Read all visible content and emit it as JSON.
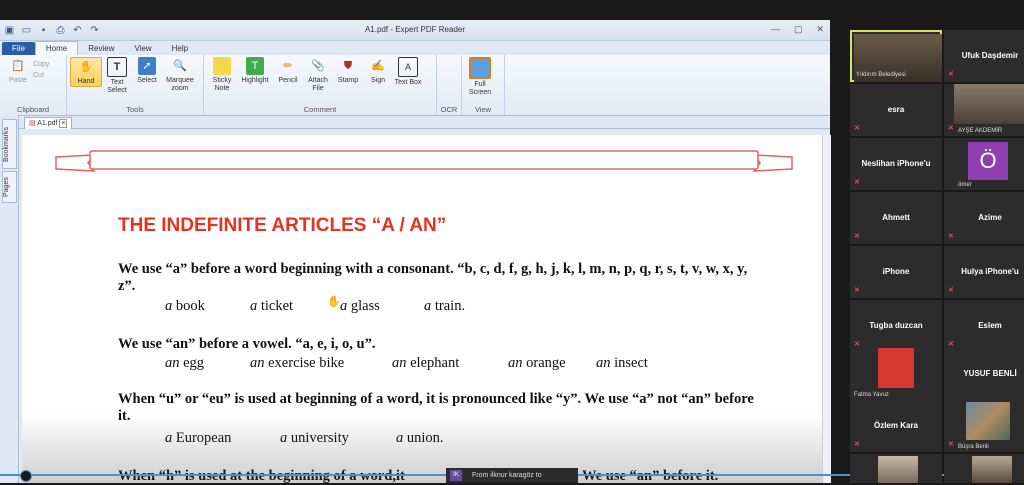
{
  "window_title": "A1.pdf - Expert PDF Reader",
  "tabs": [
    "File",
    "Home",
    "Review",
    "View",
    "Help"
  ],
  "ribbon": {
    "clipboard": {
      "label": "Clipboard",
      "paste": "Paste",
      "copy": "Copy",
      "cut": "Cut"
    },
    "tools": {
      "label": "Tools",
      "hand": "Hand",
      "text_select": "Text Select",
      "select": "Select",
      "marquee_zoom": "Marquee zoom"
    },
    "comment": {
      "label": "Comment",
      "sticky_note": "Sticky Note",
      "highlight": "Highlight",
      "pencil": "Pencil",
      "attach_file": "Attach File",
      "stamp": "Stamp",
      "sign": "Sign",
      "text_box": "Text Box"
    },
    "ocr": {
      "label": "OCR"
    },
    "view": {
      "label": "View",
      "full_screen": "Full Screen"
    }
  },
  "doc_tab": "A1.pdf",
  "side_tabs": [
    "Bookmarks",
    "Pages"
  ],
  "document": {
    "heading": "THE INDEFINITE ARTICLES “A / AN”",
    "p1": "We use “a” before a word beginning with a consonant. “b, c, d, f, g, h, j, k, l, m, n, p, q, r, s, t, v, w, x, y, z”.",
    "ex1": [
      [
        "a",
        "book"
      ],
      [
        "a",
        "ticket"
      ],
      [
        "a",
        "glass"
      ],
      [
        "a",
        "train."
      ]
    ],
    "p2": "We use “an” before a vowel. “a, e, i, o, u”.",
    "ex2": [
      [
        "an",
        "egg"
      ],
      [
        "an",
        "exercise bike"
      ],
      [
        "an",
        "elephant"
      ],
      [
        "an",
        "orange"
      ],
      [
        "an",
        "insect"
      ]
    ],
    "p3": "When “u” or “eu” is used at beginning of a word, it is pronounced like “y”. We use “a” not “an” before it.",
    "ex3": [
      [
        "a",
        "European"
      ],
      [
        "a",
        "university"
      ],
      [
        "a",
        "union."
      ]
    ],
    "p4_start": "When “h” is used at the beginning of a word,it",
    "p4_end": "We use “an” before it."
  },
  "notification": {
    "avatar": "IK",
    "text": "From ilknur karagöz to"
  },
  "participants": [
    {
      "name": "Yıldırım Belediyesi",
      "video": true
    },
    {
      "name": "Ufuk Daşdemir"
    },
    {
      "name": "esra"
    },
    {
      "name": "AYŞE AKDEMİR",
      "video": true
    },
    {
      "name": "Neslihan iPhone'u"
    },
    {
      "name": "ömer",
      "avatar": "Ö"
    },
    {
      "name": "Ahmett"
    },
    {
      "name": "Azime"
    },
    {
      "name": "iPhone"
    },
    {
      "name": "Hulya iPhone'u"
    },
    {
      "name": "Tugba duzcan"
    },
    {
      "name": "Eslem"
    },
    {
      "name": "Fatma Yavuz",
      "video": true
    },
    {
      "name": "YUSUF BENLİ"
    },
    {
      "name": "Özlem Kara"
    },
    {
      "name": "Büşra Benli",
      "video": true
    }
  ],
  "colors": {
    "heading": "#e8321f",
    "ribbon_file": "#2a5caa",
    "avatar_o": "#8e3fb0"
  }
}
